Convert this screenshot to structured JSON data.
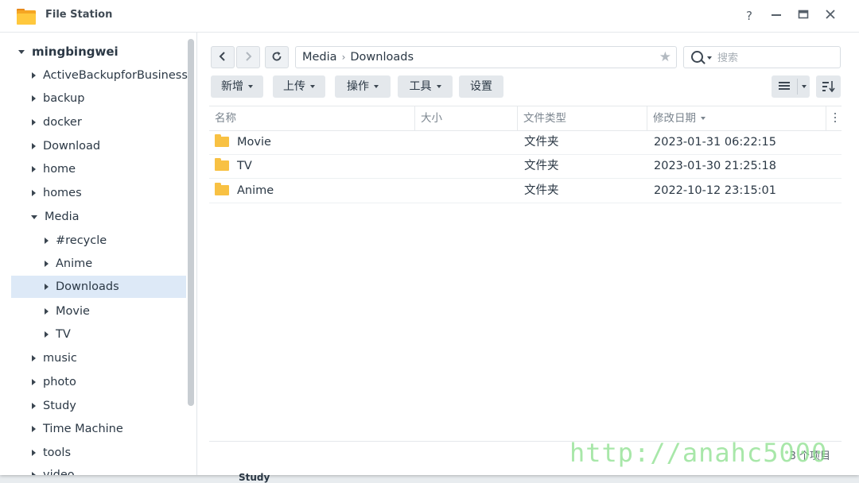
{
  "window": {
    "title": "File Station",
    "help_label": "?",
    "minimize_label": "—",
    "maximize_label": "▭",
    "close_label": "✕"
  },
  "sidebar": {
    "root": "mingbingwei",
    "items": [
      {
        "label": "ActiveBackupforBusiness"
      },
      {
        "label": "backup"
      },
      {
        "label": "docker"
      },
      {
        "label": "Download"
      },
      {
        "label": "home"
      },
      {
        "label": "homes"
      },
      {
        "label": "Media"
      },
      {
        "label": "#recycle"
      },
      {
        "label": "Anime"
      },
      {
        "label": "Downloads"
      },
      {
        "label": "Movie"
      },
      {
        "label": "TV"
      },
      {
        "label": "music"
      },
      {
        "label": "photo"
      },
      {
        "label": "Study"
      },
      {
        "label": "Time Machine"
      },
      {
        "label": "tools"
      },
      {
        "label": "video"
      }
    ]
  },
  "nav": {
    "back": "‹",
    "forward": "›",
    "refresh": "↻"
  },
  "path": {
    "segments": [
      "Media",
      "Downloads"
    ],
    "separator": "›",
    "star": "★"
  },
  "search": {
    "placeholder": "搜索"
  },
  "toolbar": {
    "new_label": "新增",
    "upload_label": "上传",
    "action_label": "操作",
    "tools_label": "工具",
    "settings_label": "设置"
  },
  "table": {
    "headers": {
      "name": "名称",
      "size": "大小",
      "type": "文件类型",
      "modified": "修改日期"
    },
    "rows": [
      {
        "name": "Movie",
        "size": "",
        "type": "文件夹",
        "modified": "2023-01-31 06:22:15"
      },
      {
        "name": "TV",
        "size": "",
        "type": "文件夹",
        "modified": "2023-01-30 21:25:18"
      },
      {
        "name": "Anime",
        "size": "",
        "type": "文件夹",
        "modified": "2022-10-12 23:15:01"
      }
    ]
  },
  "status": {
    "count_text": "3 个项目"
  },
  "watermark": {
    "text": "http://anahc5000"
  },
  "background": {
    "peek_text": "Study"
  },
  "colors": {
    "selected_bg": "#dde9f7",
    "folder": "#f8c143",
    "button_bg": "#e4e8ec"
  }
}
